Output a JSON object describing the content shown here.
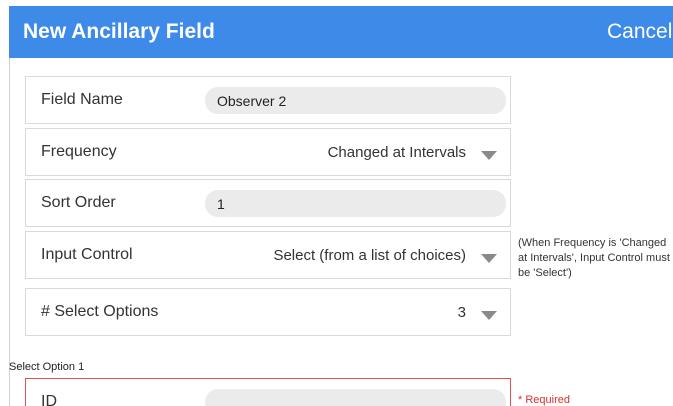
{
  "header": {
    "title": "New Ancillary Field",
    "cancel_label": "Cancel"
  },
  "form": {
    "field_name": {
      "label": "Field Name",
      "value": "Observer 2"
    },
    "frequency": {
      "label": "Frequency",
      "value": "Changed at Intervals"
    },
    "sort_order": {
      "label": "Sort Order",
      "value": "1"
    },
    "input_control": {
      "label": "Input Control",
      "value": "Select (from a list of choices)",
      "note": "(When Frequency is 'Changed at Intervals', Input Control must be 'Select')"
    },
    "select_options": {
      "label": "# Select Options",
      "value": "3"
    }
  },
  "option_section": {
    "title": "Select Option 1",
    "id_label": "ID",
    "id_value": "",
    "required_text": "* Required"
  },
  "colors": {
    "header_bg": "#3e8ae8",
    "error_border": "#e35050",
    "required_text": "#d9302c"
  }
}
